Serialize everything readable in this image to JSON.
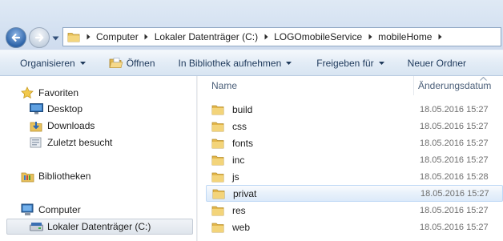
{
  "address_bar": {
    "breadcrumbs": [
      "Computer",
      "Lokaler Datenträger (C:)",
      "LOGOmobileService",
      "mobileHome"
    ]
  },
  "toolbar": {
    "organize_label": "Organisieren",
    "open_label": "Öffnen",
    "library_label": "In Bibliothek aufnehmen",
    "share_label": "Freigeben für",
    "new_folder_label": "Neuer Ordner"
  },
  "nav_pane": {
    "favorites_label": "Favoriten",
    "favorites": [
      {
        "label": "Desktop",
        "icon": "desktop-icon"
      },
      {
        "label": "Downloads",
        "icon": "downloads-icon"
      },
      {
        "label": "Zuletzt besucht",
        "icon": "recent-places-icon"
      }
    ],
    "libraries_label": "Bibliotheken",
    "computer_label": "Computer",
    "drive_label": "Lokaler Datenträger (C:)"
  },
  "file_list": {
    "columns": {
      "name": "Name",
      "modified": "Änderungsdatum"
    },
    "rows": [
      {
        "name": "build",
        "modified": "18.05.2016 15:27"
      },
      {
        "name": "css",
        "modified": "18.05.2016 15:27"
      },
      {
        "name": "fonts",
        "modified": "18.05.2016 15:27"
      },
      {
        "name": "inc",
        "modified": "18.05.2016 15:27"
      },
      {
        "name": "js",
        "modified": "18.05.2016 15:28"
      },
      {
        "name": "privat",
        "modified": "18.05.2016 15:27",
        "hovered": true
      },
      {
        "name": "res",
        "modified": "18.05.2016 15:27"
      },
      {
        "name": "web",
        "modified": "18.05.2016 15:27"
      }
    ]
  },
  "colors": {
    "hover_row": "#dceafa",
    "folder": "#e8c15c",
    "link_text": "#1e395b"
  }
}
